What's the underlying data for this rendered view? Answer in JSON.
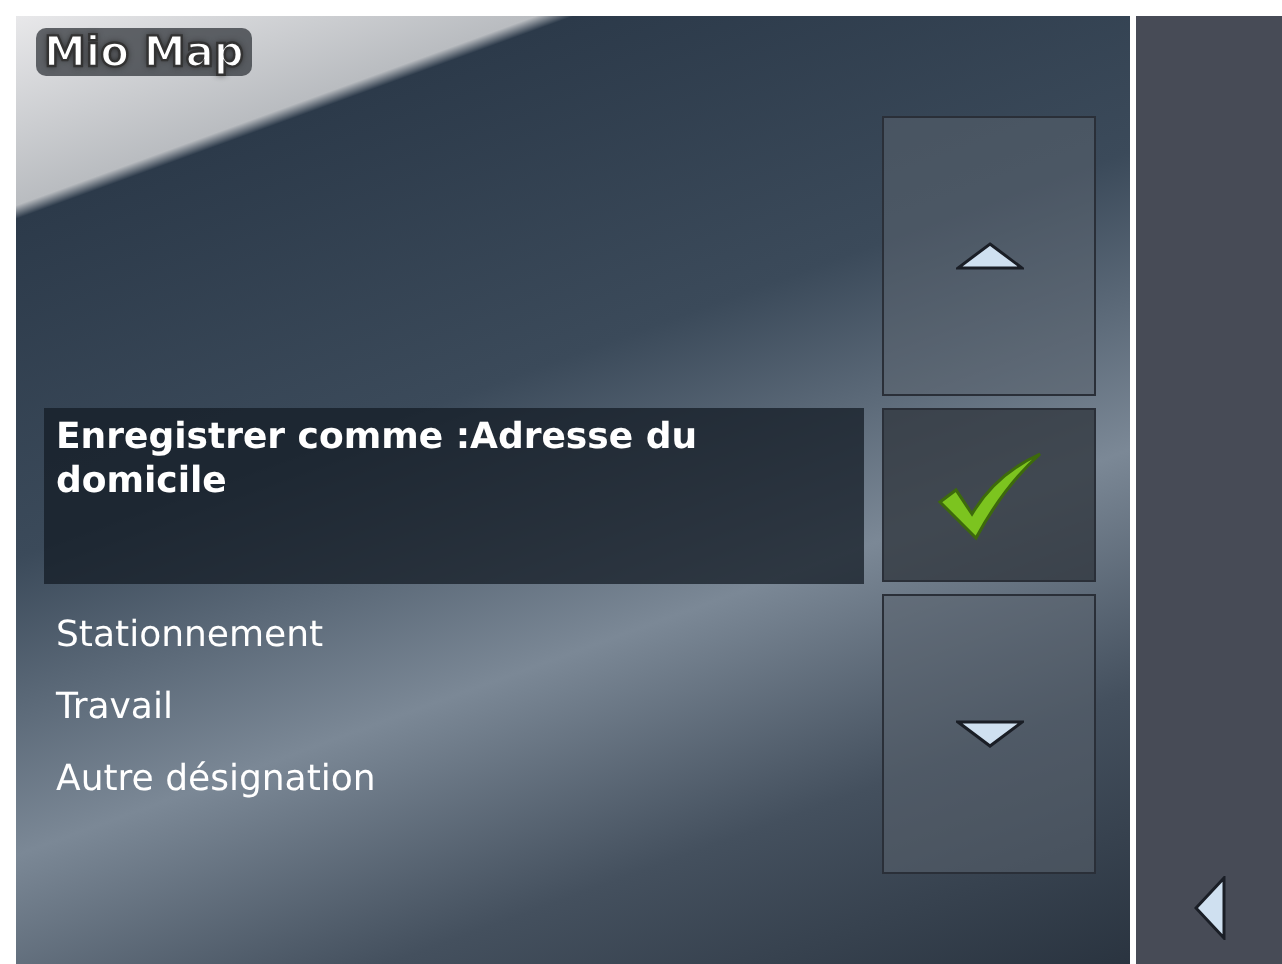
{
  "app": {
    "logo": "Mio Map"
  },
  "options": [
    {
      "label": "Enregistrer comme :Adresse du domicile",
      "selected": true
    },
    {
      "label": "Stationnement",
      "selected": false
    },
    {
      "label": "Travail",
      "selected": false
    },
    {
      "label": "Autre désignation",
      "selected": false
    }
  ],
  "buttons": [
    {
      "kind": "up"
    },
    {
      "kind": "confirm"
    },
    {
      "kind": "down"
    }
  ],
  "side_panel": {
    "buttons": [
      {
        "kind": "back"
      }
    ]
  }
}
